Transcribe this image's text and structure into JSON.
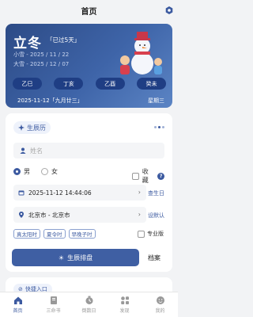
{
  "header": {
    "title": "首页"
  },
  "hero": {
    "term": "立冬",
    "since": "「已过5天」",
    "prev_term": "小雪 - 2025 / 11 / 22",
    "next_term": "大雪 - 2025 / 12 / 07",
    "ganzhi": [
      "乙巳",
      "丁亥",
      "乙酉",
      "癸未"
    ],
    "date_line": "2025-11-12「九月廿三」",
    "weekday": "星期三"
  },
  "form": {
    "tab_label": "生辰历",
    "name_placeholder": "姓名",
    "gender_male": "男",
    "gender_female": "女",
    "favorite_label": "收藏",
    "datetime_value": "2025-11-12 14:44:06",
    "datetime_link": "查生日",
    "location_value": "北京市 - 北京市",
    "location_link": "设默认",
    "options": [
      "真太阳时",
      "夏令时",
      "早晚子时"
    ],
    "pro_label": "专业版",
    "submit_label": "生辰排盘",
    "archive_label": "档案"
  },
  "quick": {
    "label": "快捷入口"
  },
  "tabbar": {
    "items": [
      {
        "label": "首页",
        "icon": "home-icon"
      },
      {
        "label": "三命书",
        "icon": "book-icon"
      },
      {
        "label": "倒数日",
        "icon": "timer-icon"
      },
      {
        "label": "发现",
        "icon": "grid-icon"
      },
      {
        "label": "我的",
        "icon": "user-icon"
      }
    ]
  },
  "colors": {
    "accent": "#3c5aa0",
    "hero_bg": "#3e64a8",
    "pill": "#1f3e84"
  }
}
